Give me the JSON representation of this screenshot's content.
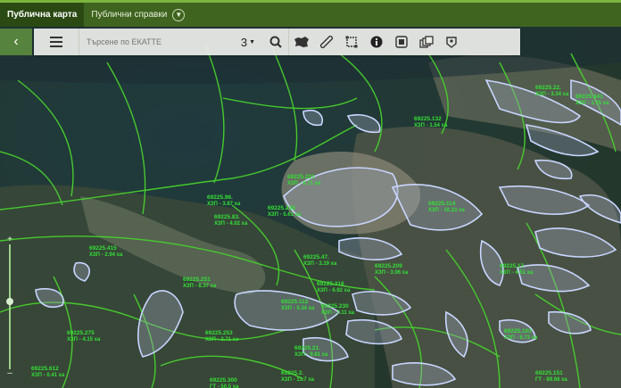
{
  "tabs": [
    {
      "label": "Публична карта",
      "active": true
    },
    {
      "label": "Публични справки",
      "active": false
    }
  ],
  "toolbar": {
    "search_placeholder": "Търсене по ЕКАТТЕ",
    "zoom_value": "3",
    "tools": [
      "search-icon",
      "bulgaria-map-icon",
      "ruler-icon",
      "area-measure-icon",
      "info-icon",
      "print-icon",
      "layers-icon",
      "marker-icon"
    ]
  },
  "map": {
    "labels": [
      {
        "id": "69225.96.",
        "text": "69225.96.",
        "sub": "ХЗП - 3.87 ха"
      },
      {
        "id": "69225.221",
        "text": "69225.221",
        "sub": "ХЗП - 6.71 ха"
      },
      {
        "id": "69225.83",
        "text": "69225.83.",
        "sub": "ХЗП - 4.02 ха"
      },
      {
        "id": "69225.415",
        "text": "69225.415",
        "sub": "ХЗП - 2.94 ха"
      },
      {
        "id": "69225.132",
        "text": "69225.132",
        "sub": "ХЗП - 1.54 ха"
      },
      {
        "id": "69225.238",
        "text": "69225.238",
        "sub": "ХЗП - 5.61 ха"
      },
      {
        "id": "69225.251",
        "text": "69225.251",
        "sub": "ХЗП - 8.37 ха"
      },
      {
        "id": "69225.114",
        "text": "69225.114",
        "sub": "ХЗП - 10.23 ха"
      },
      {
        "id": "69225.47",
        "text": "69225.47.",
        "sub": "ХЗП - 3.19 ха"
      },
      {
        "id": "69225.316",
        "text": "69225.316",
        "sub": "ХЗП - 6.92 ха"
      },
      {
        "id": "69225.275",
        "text": "69225.275",
        "sub": "ХЗП - 4.15 ха"
      },
      {
        "id": "69225.612",
        "text": "69225.612",
        "sub": "ХЗП - 0.41 ха"
      },
      {
        "id": "69225.253",
        "text": "69225.253",
        "sub": "ХЗП - 2.71 ха"
      },
      {
        "id": "69225.112",
        "text": "69225.112",
        "sub": "ХЗП - 0.34 ха"
      },
      {
        "id": "69225.230",
        "text": "69225.230",
        "sub": "ХЗП - 7.11 ха"
      },
      {
        "id": "69225.2",
        "text": "69225.2.",
        "sub": "ХЗП - 11.7 ха"
      },
      {
        "id": "69225.21",
        "text": "69225.21.",
        "sub": "ХЗП - 9.81 ха"
      },
      {
        "id": "69225.209",
        "text": "69225.209",
        "sub": "ХЗП - 3.06 ха"
      },
      {
        "id": "69225.300",
        "text": "69225.300",
        "sub": "ГТ - 50.5 ха"
      },
      {
        "id": "69225.103",
        "text": "69225.103",
        "sub": "ХЗП - 6.73 ха"
      },
      {
        "id": "69225.151",
        "text": "69225.151",
        "sub": "ГТ - 89.66 ха"
      },
      {
        "id": "69225.22",
        "text": "69225.22.",
        "sub": "ХЗП - 3.34 ха"
      },
      {
        "id": "69225.441",
        "text": "69225.441",
        "sub": "ХЗП - 1.76 ха"
      },
      {
        "id": "69225.17",
        "text": "69225.17.",
        "sub": "ХЗП - 4.51 ха"
      }
    ]
  }
}
